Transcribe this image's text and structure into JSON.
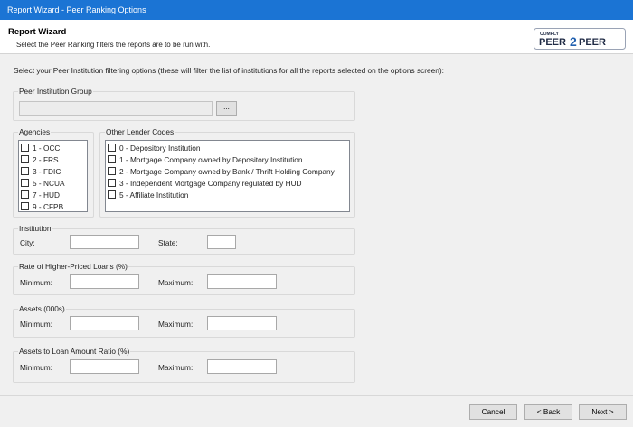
{
  "window": {
    "title": "Report Wizard - Peer Ranking Options"
  },
  "header": {
    "title": "Report Wizard",
    "subtitle": "Select the Peer Ranking filters the reports are to be run with.",
    "logo_text": "PEER2PEER",
    "logo_small_text": "COMPLY"
  },
  "instruction": "Select your Peer Institution filtering options (these will filter the list of institutions for all the reports selected on the options screen):",
  "peer_group": {
    "label": "Peer Institution Group",
    "value": "",
    "browse_label": "..."
  },
  "agencies": {
    "label": "Agencies",
    "items": [
      {
        "label": "1 - OCC",
        "checked": false
      },
      {
        "label": "2 - FRS",
        "checked": false
      },
      {
        "label": "3 - FDIC",
        "checked": false
      },
      {
        "label": "5 - NCUA",
        "checked": false
      },
      {
        "label": "7 - HUD",
        "checked": false
      },
      {
        "label": "9 - CFPB",
        "checked": false
      }
    ]
  },
  "lender_codes": {
    "label": "Other Lender Codes",
    "items": [
      {
        "label": "0 - Depository Institution",
        "checked": false
      },
      {
        "label": "1 - Mortgage Company owned by Depository Institution",
        "checked": false
      },
      {
        "label": "2 - Mortgage Company owned by Bank / Thrift Holding Company",
        "checked": false
      },
      {
        "label": "3 - Independent Mortgage Company regulated by HUD",
        "checked": false
      },
      {
        "label": "5 - Affiliate Institution",
        "checked": false
      }
    ]
  },
  "institution": {
    "label": "Institution",
    "city_label": "City:",
    "city_value": "",
    "state_label": "State:",
    "state_value": ""
  },
  "rate_loans": {
    "label": "Rate of Higher-Priced Loans (%)",
    "min_label": "Minimum:",
    "min_value": "",
    "max_label": "Maximum:",
    "max_value": ""
  },
  "assets": {
    "label": "Assets (000s)",
    "min_label": "Minimum:",
    "min_value": "",
    "max_label": "Maximum:",
    "max_value": ""
  },
  "assets_ratio": {
    "label": "Assets to Loan Amount Ratio (%)",
    "min_label": "Minimum:",
    "min_value": "",
    "max_label": "Maximum:",
    "max_value": ""
  },
  "footer": {
    "cancel_label": "Cancel",
    "back_label": "< Back",
    "next_label": "Next >"
  },
  "colors": {
    "titlebar": "#1b74d4",
    "logo_dark": "#1f2a44",
    "logo_accent": "#2060b0"
  }
}
